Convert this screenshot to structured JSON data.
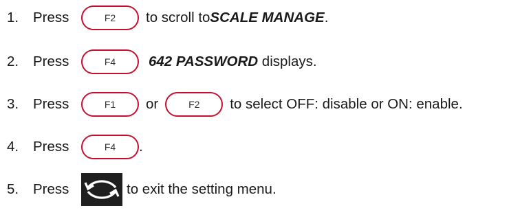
{
  "steps": [
    {
      "number": "1.",
      "press": "Press",
      "key1": "F2",
      "text1": "to scroll to ",
      "emph": "SCALE MANAGE",
      "text2": "."
    },
    {
      "number": "2.",
      "press": "Press",
      "key1": "F4",
      "emph": "642 PASSWORD",
      "text1": " displays."
    },
    {
      "number": "3.",
      "press": "Press",
      "key1": "F1",
      "or": "or",
      "key2": "F2",
      "text1": "to select OFF: disable or ON: enable."
    },
    {
      "number": "4.",
      "press": "Press",
      "key1": "F4",
      "text1": "."
    },
    {
      "number": "5.",
      "press": "Press",
      "icon": "menu-exit-arrows-icon",
      "text1": "to exit the setting menu."
    }
  ],
  "colors": {
    "key_border": "#c8102e",
    "icon_bg": "#1f1f1f",
    "icon_fg": "#ffffff",
    "text": "#1a1a1a"
  }
}
